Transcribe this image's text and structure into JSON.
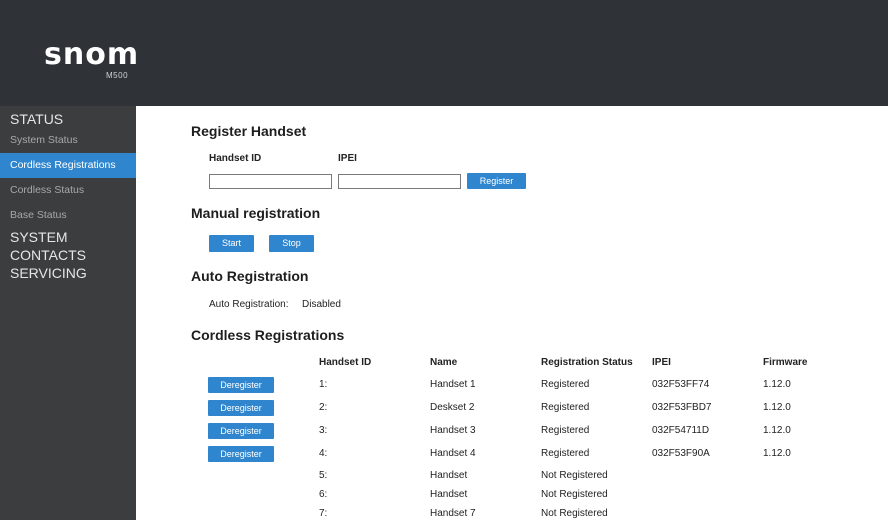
{
  "logo": {
    "brand": "snom",
    "model": "M500"
  },
  "sidebar": {
    "sections": [
      {
        "label": "STATUS",
        "items": [
          {
            "label": "System Status",
            "active": false
          },
          {
            "label": "Cordless Registrations",
            "active": true
          },
          {
            "label": "Cordless Status",
            "active": false
          },
          {
            "label": "Base Status",
            "active": false
          }
        ]
      },
      {
        "label": "SYSTEM",
        "items": []
      },
      {
        "label": "CONTACTS",
        "items": []
      },
      {
        "label": "SERVICING",
        "items": []
      }
    ]
  },
  "register_handset": {
    "title": "Register Handset",
    "handset_id_label": "Handset ID",
    "ipei_label": "IPEI",
    "handset_id_value": "",
    "ipei_value": "",
    "register_button": "Register"
  },
  "manual_registration": {
    "title": "Manual registration",
    "start_button": "Start",
    "stop_button": "Stop"
  },
  "auto_registration": {
    "title": "Auto Registration",
    "label": "Auto Registration:",
    "value": "Disabled"
  },
  "cordless_registrations": {
    "title": "Cordless Registrations",
    "columns": [
      "Handset ID",
      "Name",
      "Registration Status",
      "IPEI",
      "Firmware"
    ],
    "deregister_label": "Deregister",
    "rows": [
      {
        "id": "1:",
        "name": "Handset 1",
        "status": "Registered",
        "ipei": "032F53FF74",
        "firmware": "1.12.0",
        "deregister": true
      },
      {
        "id": "2:",
        "name": "Deskset 2",
        "status": "Registered",
        "ipei": "032F53FBD7",
        "firmware": "1.12.0",
        "deregister": true
      },
      {
        "id": "3:",
        "name": "Handset 3",
        "status": "Registered",
        "ipei": "032F54711D",
        "firmware": "1.12.0",
        "deregister": true
      },
      {
        "id": "4:",
        "name": "Handset 4",
        "status": "Registered",
        "ipei": "032F53F90A",
        "firmware": "1.12.0",
        "deregister": true
      },
      {
        "id": "5:",
        "name": "Handset",
        "status": "Not Registered",
        "ipei": "",
        "firmware": "",
        "deregister": false
      },
      {
        "id": "6:",
        "name": "Handset",
        "status": "Not Registered",
        "ipei": "",
        "firmware": "",
        "deregister": false
      },
      {
        "id": "7:",
        "name": "Handset 7",
        "status": "Not Registered",
        "ipei": "",
        "firmware": "",
        "deregister": false
      }
    ]
  },
  "colors": {
    "accent": "#2f86cf",
    "header_bg": "#2f3236",
    "sidebar_bg": "#3c3d3f"
  }
}
